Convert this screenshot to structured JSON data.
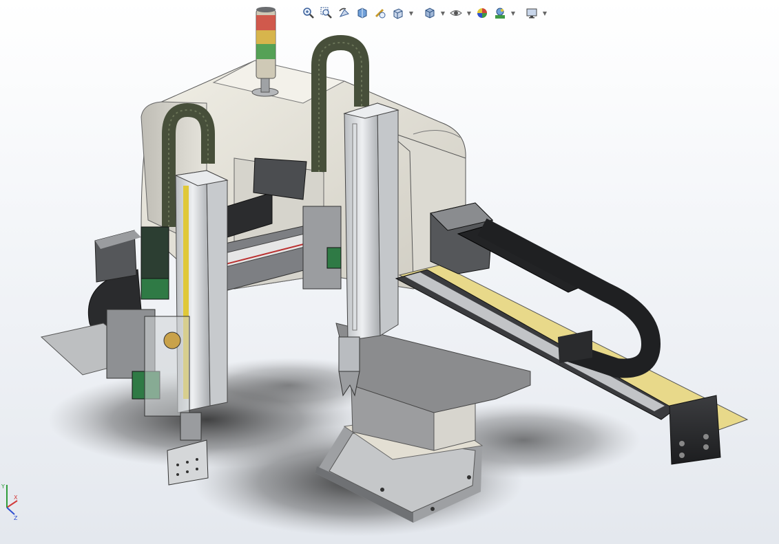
{
  "heads_up_toolbar": {
    "tools": [
      {
        "icon": "zoom-to-fit-icon",
        "has_menu": false
      },
      {
        "icon": "zoom-to-area-icon",
        "has_menu": false
      },
      {
        "icon": "previous-view-icon",
        "has_menu": false
      },
      {
        "icon": "section-view-icon",
        "has_menu": false
      },
      {
        "icon": "dynamic-annotation-views-icon",
        "has_menu": false
      },
      {
        "icon": "view-orientation-icon",
        "has_menu": true
      },
      {
        "icon": "display-style-icon",
        "has_menu": true
      },
      {
        "icon": "hide-show-items-icon",
        "has_menu": true
      },
      {
        "icon": "edit-appearance-icon",
        "has_menu": false
      },
      {
        "icon": "apply-scene-icon",
        "has_menu": true
      },
      {
        "icon": "view-settings-icon",
        "has_menu": true
      }
    ]
  },
  "triad": {
    "axes": [
      "X",
      "Y",
      "Z"
    ],
    "colors": {
      "x": "#d23a3a",
      "y": "#2e9c3a",
      "z": "#2e4fd0"
    }
  },
  "model": {
    "beacon_colors": [
      "#d0453a",
      "#d8b23a",
      "#3f9a45"
    ],
    "body_color": "#d9d6cc",
    "frame_color": "#8c8d8f",
    "accent_yellow": "#e8d98a",
    "cable_carrier_color": "#474f3a"
  }
}
